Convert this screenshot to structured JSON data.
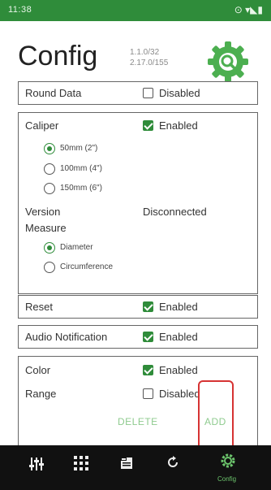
{
  "status_bar": {
    "time": "11:38",
    "right_icons": "⊙ ▾◣▮"
  },
  "header": {
    "title": "Config",
    "version_line1": "1.1.0/32",
    "version_line2": "2.17.0/155",
    "gear_icon": "gear-icon"
  },
  "round_data": {
    "label": "Round Data",
    "toggle_label": "Disabled",
    "checked": false
  },
  "caliper": {
    "label": "Caliper",
    "toggle_label": "Enabled",
    "checked": true,
    "sizes": [
      {
        "label": "50mm (2\")",
        "selected": true
      },
      {
        "label": "100mm (4\")",
        "selected": false
      },
      {
        "label": "150mm (6\")",
        "selected": false
      }
    ],
    "version_label": "Version",
    "version_value": "Disconnected",
    "measure_label": "Measure",
    "measure_options": [
      {
        "label": "Diameter",
        "selected": true
      },
      {
        "label": "Circumference",
        "selected": false
      }
    ]
  },
  "reset": {
    "label": "Reset",
    "toggle_label": "Enabled",
    "checked": true
  },
  "audio": {
    "label": "Audio Notification",
    "toggle_label": "Enabled",
    "checked": true
  },
  "color": {
    "label": "Color",
    "toggle_label": "Enabled",
    "checked": true
  },
  "range": {
    "label": "Range",
    "toggle_label": "Disabled",
    "checked": false
  },
  "actions": {
    "delete_label": "DELETE",
    "add_label": "ADD"
  },
  "nav": {
    "items": [
      {
        "icon": "sliders-icon"
      },
      {
        "icon": "grid-icon"
      },
      {
        "icon": "document-icon"
      },
      {
        "icon": "sync-icon"
      },
      {
        "icon": "gear-icon",
        "label": "Config"
      }
    ]
  },
  "colors": {
    "accent": "#2f8c3a",
    "highlight": "#d63333",
    "button_text": "#8fcb8f"
  }
}
